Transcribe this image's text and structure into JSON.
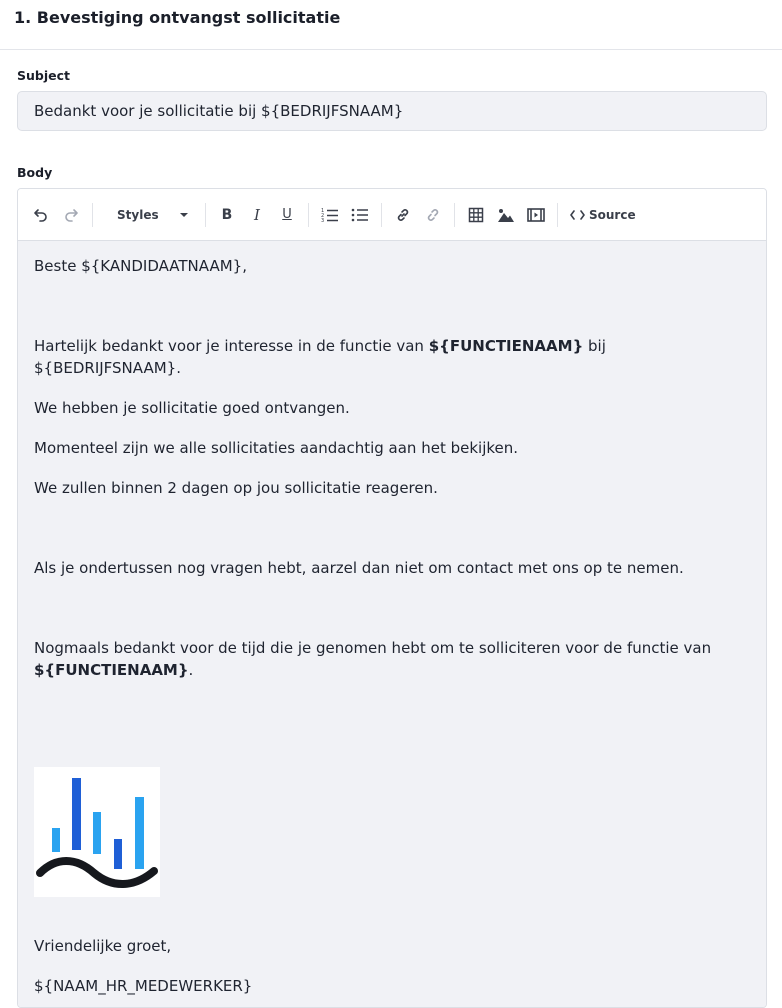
{
  "header": {
    "title": "1. Bevestiging ontvangst sollicitatie"
  },
  "subject": {
    "label": "Subject",
    "value": "Bedankt voor je sollicitatie bij ${BEDRIJFSNAAM}"
  },
  "body": {
    "label": "Body",
    "toolbar": {
      "styles_label": "Styles",
      "source_label": "Source",
      "icons": [
        "undo-icon",
        "redo-icon",
        "chevron-down-icon",
        "bold-icon",
        "italic-icon",
        "underline-icon",
        "numbered-list-icon",
        "bulleted-list-icon",
        "link-icon",
        "unlink-icon",
        "table-icon",
        "image-icon",
        "video-icon",
        "code-icon"
      ]
    },
    "content": {
      "greeting": "Beste ${KANDIDAATNAAM},",
      "p1_before": "Hartelijk bedankt voor je interesse in de functie van ",
      "p1_bold": "${FUNCTIENAAM}",
      "p1_after": " bij ${BEDRIJFSNAAM}.",
      "p2": "We hebben je sollicitatie goed ontvangen.",
      "p3": "Momenteel zijn we alle sollicitaties aandachtig aan het bekijken.",
      "p4": "We zullen binnen 2 dagen op jou sollicitatie reageren.",
      "p5": "Als je ondertussen nog vragen hebt, aarzel dan niet om contact met ons op te nemen.",
      "p6_before": "Nogmaals bedankt voor de tijd die je genomen hebt om te solliciteren voor de functie van",
      "p6_bold": "${FUNCTIENAAM}",
      "p6_after": ".",
      "closing": "Vriendelijke groet,",
      "signature": "${NAAM_HR_MEDEWERKER}"
    },
    "colors": {
      "logo_bar_dark": "#1f5fd6",
      "logo_bar_light": "#2aa3f0",
      "logo_wave": "#16181d"
    }
  }
}
